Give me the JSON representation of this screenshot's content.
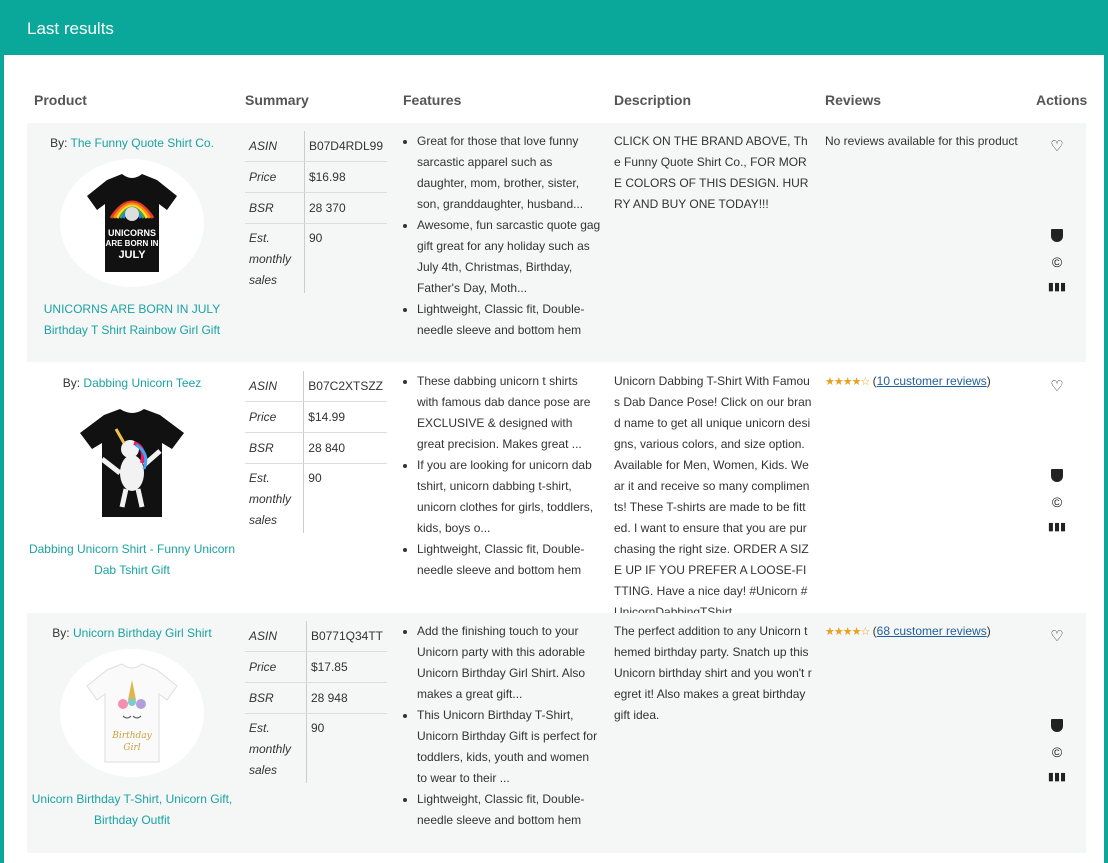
{
  "header": {
    "title": "Last results"
  },
  "columns": [
    "Product",
    "Summary",
    "Features",
    "Description",
    "Reviews",
    "Actions"
  ],
  "summary_labels": {
    "asin": "ASIN",
    "price": "Price",
    "bsr": "BSR",
    "sales": "Est. monthly sales"
  },
  "products": [
    {
      "by_prefix": "By:",
      "brand": "The Funny Quote Shirt Co.",
      "title": "UNICORNS ARE BORN IN JULY Birthday T Shirt Rainbow Girl Gift",
      "shirt_text": "UNICORNS ARE BORN IN JULY",
      "asin": "B07D4RDL99",
      "price": "$16.98",
      "bsr": "28 370",
      "sales": "90",
      "features": [
        "Great for those that love funny sarcastic apparel such as daughter, mom, brother, sister, son, granddaughter, husband...",
        "Awesome, fun sarcastic quote gag gift great for any holiday such as July 4th, Christmas, Birthday, Father's Day, Moth...",
        "Lightweight, Classic fit, Double-needle sleeve and bottom hem"
      ],
      "description": "CLICK ON THE BRAND ABOVE, The Funny Quote Shirt Co., FOR MORE COLORS OF THIS DESIGN. HURRY AND BUY ONE TODAY!!!",
      "reviews_text": "No reviews available for this product",
      "review_link": ""
    },
    {
      "by_prefix": "By:",
      "brand": "Dabbing Unicorn Teez",
      "title": "Dabbing Unicorn Shirt - Funny Unicorn Dab Tshirt Gift",
      "shirt_text": "",
      "asin": "B07C2XTSZZ",
      "price": "$14.99",
      "bsr": "28 840",
      "sales": "90",
      "features": [
        "These dabbing unicorn t shirts with famous dab dance pose are EXCLUSIVE & designed with great precision. Makes great ...",
        "If you are looking for unicorn dab tshirt, unicorn dabbing t-shirt, unicorn clothes for girls, toddlers, kids, boys o...",
        "Lightweight, Classic fit, Double-needle sleeve and bottom hem"
      ],
      "description": "Unicorn Dabbing T-Shirt With Famous Dab Dance Pose! Click on our brand name to get all unique unicorn designs, various colors, and size option. Available for Men, Women, Kids. Wear it and receive so many compliments! These T-shirts are made to be fitted. I want to ensure that you are purchasing the right size. ORDER A SIZE UP IF YOU PREFER A LOOSE-FITTING. Have a nice day! #Unicorn #UnicornDabbingTShirt",
      "reviews_text": "",
      "review_link": "10 customer reviews"
    },
    {
      "by_prefix": "By:",
      "brand": "Unicorn Birthday Girl Shirt",
      "title": "Unicorn Birthday T-Shirt, Unicorn Gift, Birthday Outfit",
      "shirt_text": "Birthday Girl",
      "asin": "B0771Q34TT",
      "price": "$17.85",
      "bsr": "28 948",
      "sales": "90",
      "features": [
        "Add the finishing touch to your Unicorn party with this adorable Unicorn Birthday Girl Shirt. Also makes a great gift...",
        "This Unicorn Birthday T-Shirt, Unicorn Birthday Gift is perfect for toddlers, kids, youth and women to wear to their ...",
        "Lightweight, Classic fit, Double-needle sleeve and bottom hem"
      ],
      "description": "The perfect addition to any Unicorn themed birthday party. Snatch up this Unicorn birthday shirt and you won't regret it! Also makes a great birthday gift idea.",
      "reviews_text": "",
      "review_link": "68 customer reviews"
    }
  ],
  "colors": {
    "accent": "#0aa89a",
    "link": "#1aa3a3",
    "stars": "#e6a11d"
  }
}
